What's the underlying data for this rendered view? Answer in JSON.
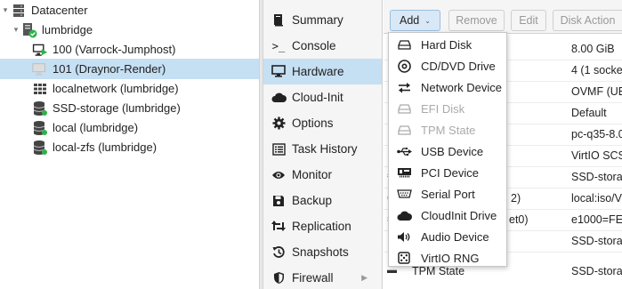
{
  "tree": {
    "datacenter": "Datacenter",
    "node": "lumbridge",
    "vm100": "100 (Varrock-Jumphost)",
    "vm101": "101 (Draynor-Render)",
    "network": "localnetwork (lumbridge)",
    "ssd": "SSD-storage (lumbridge)",
    "local": "local (lumbridge)",
    "localzfs": "local-zfs (lumbridge)"
  },
  "nav": {
    "summary": "Summary",
    "console": "Console",
    "hardware": "Hardware",
    "cloudinit": "Cloud-Init",
    "options": "Options",
    "taskhistory": "Task History",
    "monitor": "Monitor",
    "backup": "Backup",
    "replication": "Replication",
    "snapshots": "Snapshots",
    "firewall": "Firewall"
  },
  "toolbar": {
    "add": "Add",
    "remove": "Remove",
    "edit": "Edit",
    "disk_action": "Disk Action"
  },
  "hardware_values": {
    "memory": "8.00 GiB",
    "processors": "4 (1 socke",
    "bios": "OVMF (UE",
    "display": "Default",
    "machine": "pc-q35-8.0",
    "scsi": "VirtIO SCS",
    "efi": "SSD-stora",
    "cdrom_partial": "2)",
    "cdrom": "local:iso/V",
    "net_partial": "et0)",
    "net": "e1000=FE",
    "disk": "SSD-stora",
    "tpm_name": "TPM State",
    "tpm": "SSD-stora"
  },
  "menu": {
    "hard_disk": "Hard Disk",
    "cd_dvd": "CD/DVD Drive",
    "network_device": "Network Device",
    "efi_disk": "EFI Disk",
    "tpm_state": "TPM State",
    "usb_device": "USB Device",
    "pci_device": "PCI Device",
    "serial_port": "Serial Port",
    "cloudinit_drive": "CloudInit Drive",
    "audio_device": "Audio Device",
    "virtio_rng": "VirtIO RNG"
  },
  "colors": {
    "selection": "#c5dff3",
    "running_green": "#2db34a",
    "disabled_text": "#aaaaaa"
  }
}
